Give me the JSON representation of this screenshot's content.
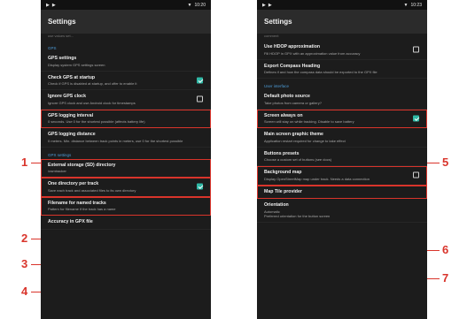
{
  "left_screen": {
    "status": {
      "time": "10:20"
    },
    "app_title": "Settings",
    "cut_text": "use values set...",
    "sections": [
      {
        "header": "GPS"
      },
      {
        "header": "GPX settings"
      }
    ],
    "items": [
      {
        "title": "GPS settings",
        "summary": "Display system GPS settings screen"
      },
      {
        "title": "Check GPS at startup",
        "summary": "Check if GPS is disabled at startup, and offer to enable it",
        "checked": true
      },
      {
        "title": "Ignore GPS clock",
        "summary": "Ignore GPS clock and use Android clock for timestamps",
        "checked": false
      },
      {
        "title": "GPS logging interval",
        "summary": "0 seconds. Use 0 for the shortest possible (affects battery life)"
      },
      {
        "title": "GPS logging distance",
        "summary": "0 meters. Min. distance between track points in meters, use 0 for the shortest possible"
      },
      {
        "title": "External storage (SD) directory",
        "summary": "/osmtracker"
      },
      {
        "title": "One directory per track",
        "summary": "Save each track and associated files to its own directory",
        "checked": true
      },
      {
        "title": "Filename for named tracks",
        "summary": "Pattern for filename if the track has a name"
      },
      {
        "title": "Accuracy in GPX file",
        "summary": ""
      }
    ]
  },
  "right_screen": {
    "status": {
      "time": "10:23"
    },
    "app_title": "Settings",
    "cut_text": "comment",
    "sections": [
      {
        "header": "User interface"
      }
    ],
    "items": [
      {
        "title": "Use HDOP approximation",
        "summary": "Fill HDOP in GPX with an approximation value from accuracy",
        "checked": false
      },
      {
        "title": "Export Compass Heading",
        "summary": "Defines if and how the compass data should be exported to the GPX file"
      },
      {
        "title": "Default photo source",
        "summary": "Take photos from camera or gallery?"
      },
      {
        "title": "Screen always on",
        "summary": "Screen will stay on while tracking. Disable to save battery",
        "checked": true
      },
      {
        "title": "Main screen graphic theme",
        "summary": "Application restart required for change to take effect"
      },
      {
        "title": "Buttons presets",
        "summary": "Choose a custom set of buttons (see docs)"
      },
      {
        "title": "Background map",
        "summary": "Display OpenStreetMap map under track. Needs a data connection",
        "checked": false
      },
      {
        "title": "Map Tile provider",
        "summary": ""
      },
      {
        "title": "Orientation",
        "summary": "Automatic\nPreferred orientation for the button screen"
      }
    ]
  },
  "callouts": [
    {
      "number": "1"
    },
    {
      "number": "2"
    },
    {
      "number": "3"
    },
    {
      "number": "4"
    },
    {
      "number": "5"
    },
    {
      "number": "6"
    },
    {
      "number": "7"
    }
  ],
  "colors": {
    "highlight": "#d9342b",
    "accent": "#2fb9a6",
    "section": "#4d9bd6",
    "background": "#1c1c1c"
  }
}
